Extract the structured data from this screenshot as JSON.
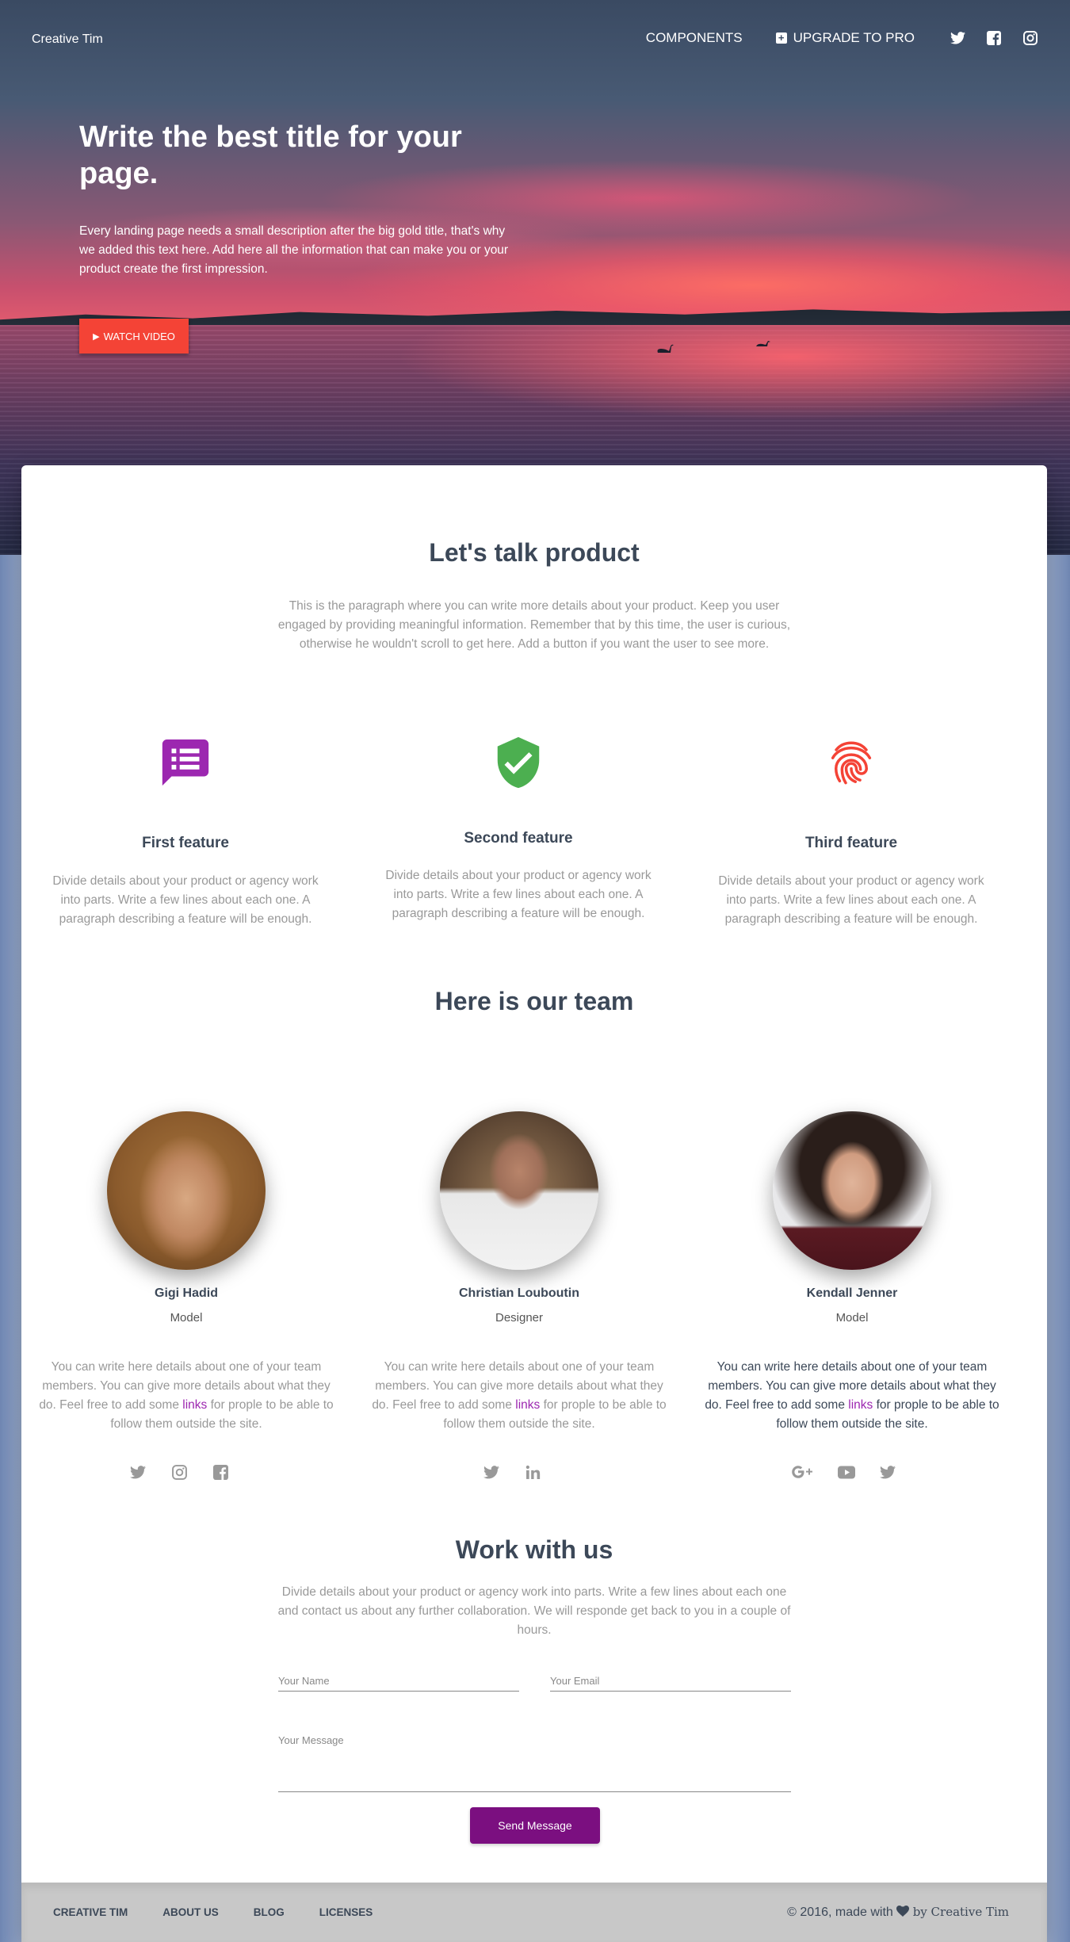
{
  "nav": {
    "brand": "Creative Tim",
    "components": "COMPONENTS",
    "upgrade": "UPGRADE TO PRO",
    "social_icons": [
      "twitter-icon",
      "facebook-icon",
      "instagram-icon"
    ]
  },
  "hero": {
    "title": "Write the best title for your page.",
    "description": "Every landing page needs a small description after the big gold title, that's why we added this text here. Add here all the information that can make you or your product create the first impression.",
    "button": "WATCH VIDEO"
  },
  "product": {
    "title": "Let's talk product",
    "description": "This is the paragraph where you can write more details about your product. Keep you user engaged by providing meaningful information. Remember that by this time, the user is curious, otherwise he wouldn't scroll to get here. Add a button if you want the user to see more."
  },
  "features": [
    {
      "title": "First feature",
      "text": "Divide details about your product or agency work into parts. Write a few lines about each one. A paragraph describing a feature will be enough.",
      "icon": "chat-list-icon",
      "color": "#9c27b0"
    },
    {
      "title": "Second feature",
      "text": "Divide details about your product or agency work into parts. Write a few lines about each one. A paragraph describing a feature will be enough.",
      "icon": "verified-shield-icon",
      "color": "#4caf50"
    },
    {
      "title": "Third feature",
      "text": "Divide details about your product or agency work into parts. Write a few lines about each one. A paragraph describing a feature will be enough.",
      "icon": "fingerprint-icon",
      "color": "#f44336"
    }
  ],
  "team": {
    "title": "Here is our team",
    "members": [
      {
        "name": "Gigi Hadid",
        "role": "Model",
        "desc_before": "You can write here details about one of your team members. You can give more details about what they do. Feel free to add some ",
        "link": "links",
        "desc_after": " for prople to be able to follow them outside the site.",
        "socials": [
          "twitter-icon",
          "instagram-icon",
          "facebook-icon"
        ]
      },
      {
        "name": "Christian Louboutin",
        "role": "Designer",
        "desc_before": "You can write here details about one of your team members. You can give more details about what they do. Feel free to add some ",
        "link": "links",
        "desc_after": " for prople to be able to follow them outside the site.",
        "socials": [
          "twitter-icon",
          "linkedin-icon"
        ]
      },
      {
        "name": "Kendall Jenner",
        "role": "Model",
        "desc_before": "You can write here details about one of your team members. You can give more details about what they do. Feel free to add some ",
        "link": "links",
        "desc_after": " for prople to be able to follow them outside the site.",
        "socials": [
          "google-plus-icon",
          "youtube-icon",
          "twitter-icon"
        ]
      }
    ]
  },
  "contact": {
    "title": "Work with us",
    "description": "Divide details about your product or agency work into parts. Write a few lines about each one and contact us about any further collaboration. We will responde get back to you in a couple of hours.",
    "name_label": "Your Name",
    "email_label": "Your Email",
    "message_label": "Your Message",
    "button": "Send Message"
  },
  "footer": {
    "links": [
      "CREATIVE TIM",
      "ABOUT US",
      "BLOG",
      "LICENSES"
    ],
    "copy_prefix": "© 2016, made with",
    "copy_suffix": "by Creative Tim"
  },
  "colors": {
    "accent": "#9c27b0",
    "danger": "#f44336",
    "success": "#4caf50",
    "button_purple": "#7b0f80"
  }
}
